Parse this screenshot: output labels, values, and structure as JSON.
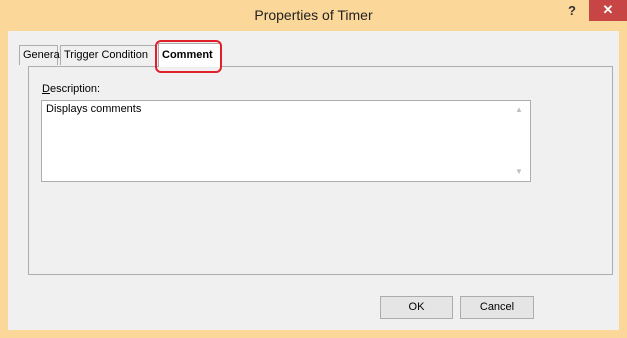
{
  "window": {
    "title": "Properties of Timer",
    "help_label": "?",
    "close_label": "✕",
    "frame_color": "#fbd79a",
    "close_color": "#c74545"
  },
  "tabs": [
    {
      "label": "General",
      "selected": false
    },
    {
      "label": "Trigger Condition",
      "selected": false
    },
    {
      "label": "Comment",
      "selected": true
    }
  ],
  "highlight_color": "#e0202a",
  "comment": {
    "description_label_accel": "D",
    "description_label_rest": "escription:",
    "description_value": "Displays comments",
    "scroll_up_icon": "▲",
    "scroll_down_icon": "▼"
  },
  "buttons": {
    "ok_label": "OK",
    "cancel_label": "Cancel"
  }
}
